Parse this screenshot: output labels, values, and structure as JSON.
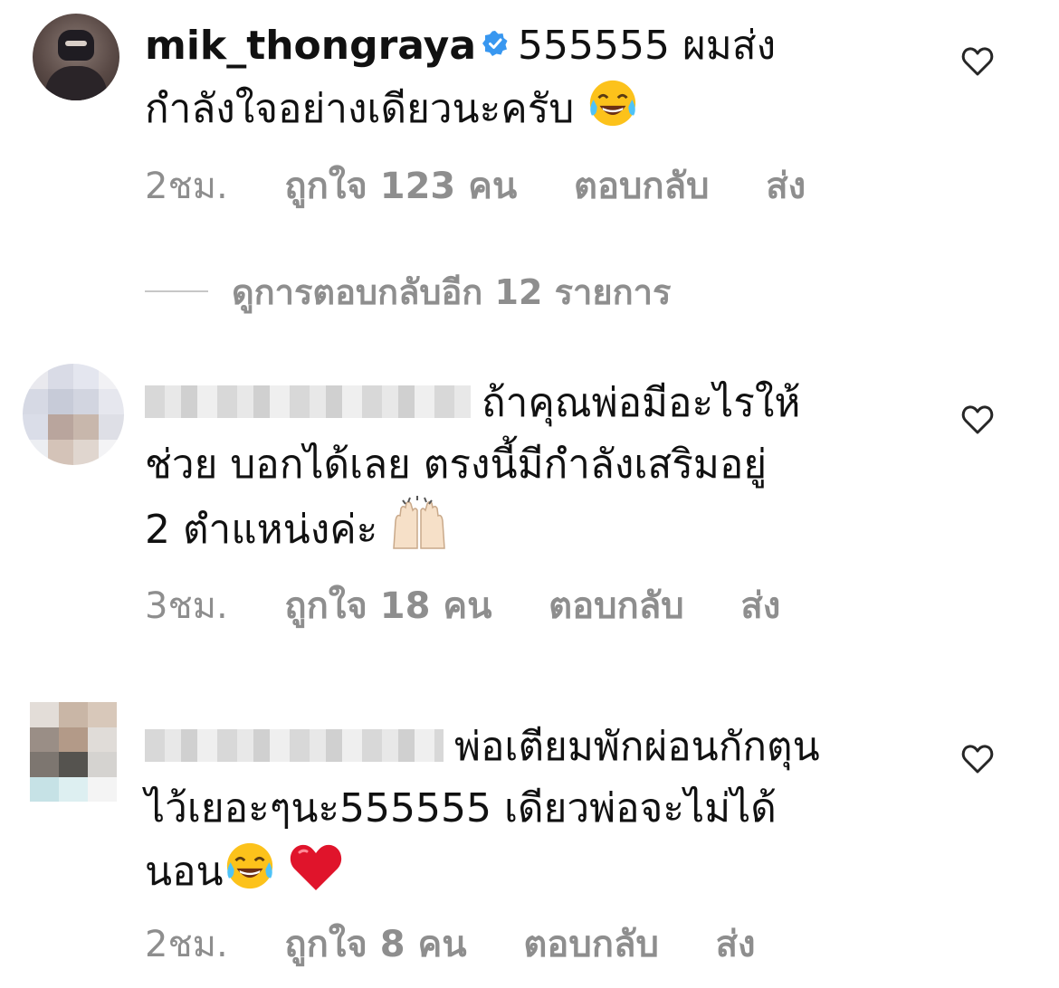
{
  "comments": [
    {
      "username": "mik_thongraya",
      "verified": true,
      "text": "555555 ผมส่ง\nกำลังใจอย่างเดียวนะครับ",
      "time": "2ชม.",
      "likes": "ถูกใจ 123 คน",
      "reply_label": "ตอบกลับ",
      "send_label": "ส่ง",
      "emojis": [
        "face-with-tears-of-joy-icon"
      ]
    },
    {
      "username": "",
      "verified": false,
      "text": "ถ้าคุณพ่อมีอะไรให้\nช่วย บอกได้เลย ตรงนี้มีกำลังเสริมอยู่\n2 ตำแหน่งค่ะ",
      "time": "3ชม.",
      "likes": "ถูกใจ 18 คน",
      "reply_label": "ตอบกลับ",
      "send_label": "ส่ง",
      "emojis": [
        "raising-hands-icon"
      ]
    },
    {
      "username": "",
      "verified": false,
      "text": "พ่อเตียมพักผ่อนกักตุน\nไว้เยอะๆนะ555555 เดียวพ่อจะไม่ได้\nนอน",
      "time": "2ชม.",
      "likes": "ถูกใจ 8 คน",
      "reply_label": "ตอบกลับ",
      "send_label": "ส่ง",
      "emojis": [
        "face-with-tears-of-joy-icon",
        "red-heart-icon"
      ]
    }
  ],
  "view_replies": "ดูการตอบกลับอีก 12 รายการ",
  "colors": {
    "text": "#111111",
    "meta": "#8e8e8e",
    "verified": "#3897f0",
    "heart_emoji": "#e0142b"
  }
}
